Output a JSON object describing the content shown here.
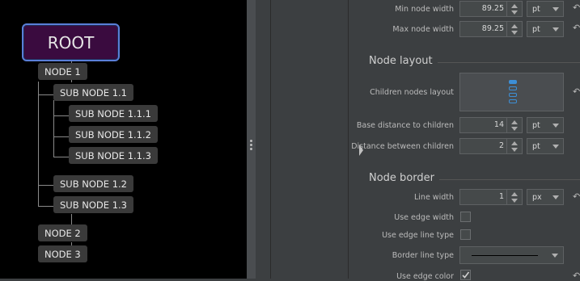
{
  "mindmap": {
    "root": "ROOT",
    "nodes": {
      "n1": "NODE 1",
      "n11": "SUB NODE 1.1",
      "n111": "SUB NODE 1.1.1",
      "n112": "SUB NODE 1.1.2",
      "n113": "SUB NODE 1.1.3",
      "n12": "SUB NODE 1.2",
      "n13": "SUB NODE 1.3",
      "n2": "NODE 2",
      "n3": "NODE 3"
    }
  },
  "panel": {
    "min_node_width": {
      "label": "Min node width",
      "value": "89.25",
      "unit": "pt"
    },
    "max_node_width": {
      "label": "Max node width",
      "value": "89.25",
      "unit": "pt"
    },
    "node_layout_title": "Node layout",
    "children_nodes_layout": {
      "label": "Children nodes layout"
    },
    "base_distance": {
      "label": "Base distance to children",
      "value": "14",
      "unit": "pt"
    },
    "distance_between": {
      "label": "Distance between children",
      "value": "2",
      "unit": "pt"
    },
    "node_border_title": "Node border",
    "line_width": {
      "label": "Line width",
      "value": "1",
      "unit": "px"
    },
    "use_edge_width": {
      "label": "Use edge width",
      "checked": false
    },
    "use_edge_line_type": {
      "label": "Use edge line type",
      "checked": false
    },
    "border_line_type": {
      "label": "Border line type"
    },
    "use_edge_color": {
      "label": "Use edge color",
      "checked": true
    }
  },
  "icons": {
    "reset": "undo-arrow-icon",
    "splitter": "vertical-ellipsis-icon"
  }
}
